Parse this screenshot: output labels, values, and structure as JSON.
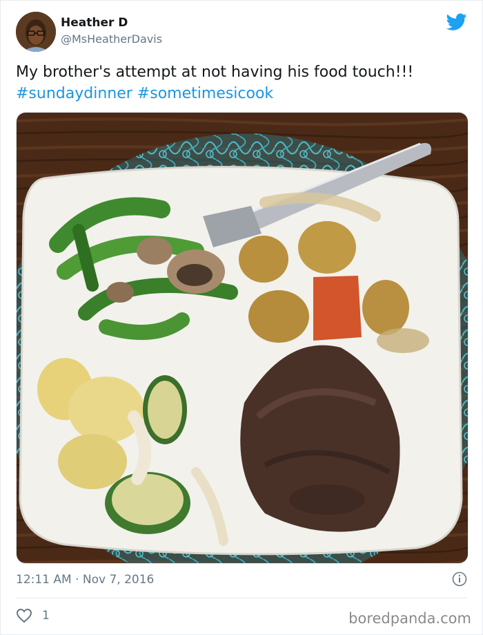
{
  "tweet": {
    "author_name": "Heather D",
    "handle": "@MsHeatherDavis",
    "text": "My brother's attempt at not having his food touch!!!",
    "hashtags": [
      "#sundaydinner",
      "#sometimesicook"
    ],
    "timestamp": "12:11 AM · Nov 7, 2016",
    "like_count": "1"
  },
  "watermark": "boredpanda.com",
  "colors": {
    "accent": "#1b95e0",
    "secondary_text": "#657786",
    "like_icon": "#657786"
  },
  "icons": {
    "brand": "twitter-bird-icon",
    "info": "info-icon",
    "like": "heart-icon"
  }
}
